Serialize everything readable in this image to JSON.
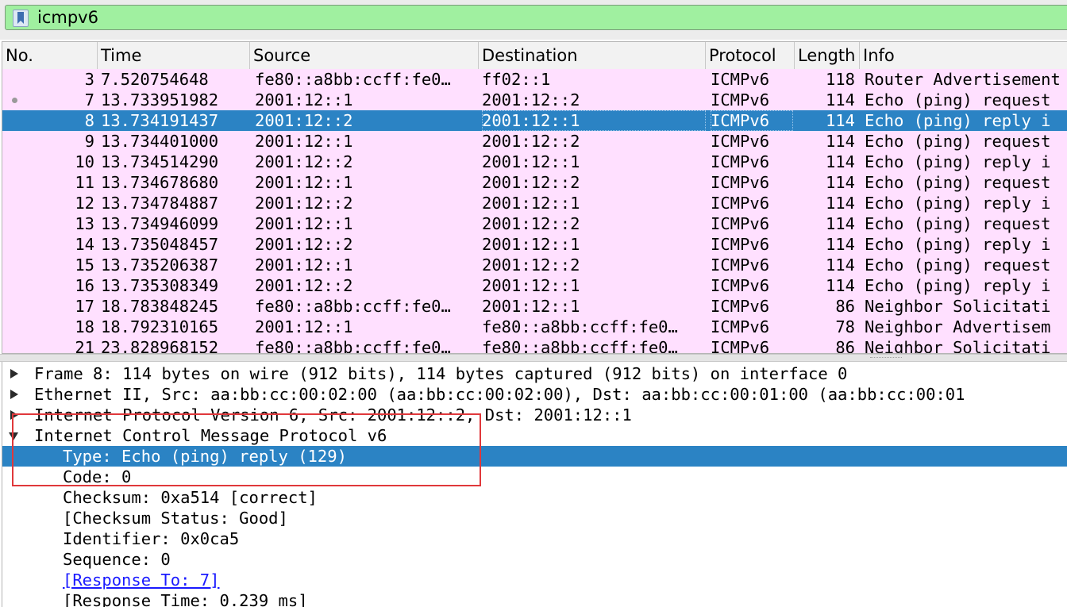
{
  "filter": {
    "value": "icmpv6",
    "icon": "bookmark-icon",
    "background": "#a0f0a0"
  },
  "packet_list": {
    "columns": [
      "No.",
      "Time",
      "Source",
      "Destination",
      "Protocol",
      "Length",
      "Info"
    ],
    "rows": [
      {
        "no": "3",
        "time": "7.520754648",
        "src": "fe80::a8bb:ccff:fe0…",
        "dst": "ff02::1",
        "proto": "ICMPv6",
        "len": "118",
        "info": "Router Advertisement",
        "selected": false,
        "related": false
      },
      {
        "no": "7",
        "time": "13.733951982",
        "src": "2001:12::1",
        "dst": "2001:12::2",
        "proto": "ICMPv6",
        "len": "114",
        "info": "Echo (ping) request",
        "selected": false,
        "related": true
      },
      {
        "no": "8",
        "time": "13.734191437",
        "src": "2001:12::2",
        "dst": "2001:12::1",
        "proto": "ICMPv6",
        "len": "114",
        "info": "Echo (ping) reply i",
        "selected": true,
        "related": false
      },
      {
        "no": "9",
        "time": "13.734401000",
        "src": "2001:12::1",
        "dst": "2001:12::2",
        "proto": "ICMPv6",
        "len": "114",
        "info": "Echo (ping) request",
        "selected": false,
        "related": false
      },
      {
        "no": "10",
        "time": "13.734514290",
        "src": "2001:12::2",
        "dst": "2001:12::1",
        "proto": "ICMPv6",
        "len": "114",
        "info": "Echo (ping) reply i",
        "selected": false,
        "related": false
      },
      {
        "no": "11",
        "time": "13.734678680",
        "src": "2001:12::1",
        "dst": "2001:12::2",
        "proto": "ICMPv6",
        "len": "114",
        "info": "Echo (ping) request",
        "selected": false,
        "related": false
      },
      {
        "no": "12",
        "time": "13.734784887",
        "src": "2001:12::2",
        "dst": "2001:12::1",
        "proto": "ICMPv6",
        "len": "114",
        "info": "Echo (ping) reply i",
        "selected": false,
        "related": false
      },
      {
        "no": "13",
        "time": "13.734946099",
        "src": "2001:12::1",
        "dst": "2001:12::2",
        "proto": "ICMPv6",
        "len": "114",
        "info": "Echo (ping) request",
        "selected": false,
        "related": false
      },
      {
        "no": "14",
        "time": "13.735048457",
        "src": "2001:12::2",
        "dst": "2001:12::1",
        "proto": "ICMPv6",
        "len": "114",
        "info": "Echo (ping) reply i",
        "selected": false,
        "related": false
      },
      {
        "no": "15",
        "time": "13.735206387",
        "src": "2001:12::1",
        "dst": "2001:12::2",
        "proto": "ICMPv6",
        "len": "114",
        "info": "Echo (ping) request",
        "selected": false,
        "related": false
      },
      {
        "no": "16",
        "time": "13.735308349",
        "src": "2001:12::2",
        "dst": "2001:12::1",
        "proto": "ICMPv6",
        "len": "114",
        "info": "Echo (ping) reply i",
        "selected": false,
        "related": false
      },
      {
        "no": "17",
        "time": "18.783848245",
        "src": "fe80::a8bb:ccff:fe0…",
        "dst": "2001:12::1",
        "proto": "ICMPv6",
        "len": "86",
        "info": "Neighbor Solicitati",
        "selected": false,
        "related": false
      },
      {
        "no": "18",
        "time": "18.792310165",
        "src": "2001:12::1",
        "dst": "fe80::a8bb:ccff:fe0…",
        "proto": "ICMPv6",
        "len": "78",
        "info": "Neighbor Advertisem",
        "selected": false,
        "related": false
      },
      {
        "no": "21",
        "time": "23.828968152",
        "src": "fe80::a8bb:ccff:fe0…",
        "dst": "fe80::a8bb:ccff:fe0…",
        "proto": "ICMPv6",
        "len": "86",
        "info": "Neighbor Solicitati",
        "selected": false,
        "related": false
      }
    ],
    "row_color": "#ffe0ff",
    "selected_color": "#2b83c4"
  },
  "detail_tree": [
    {
      "text": "Frame 8: 114 bytes on wire (912 bits), 114 bytes captured (912 bits) on interface 0",
      "level": 0,
      "arrow": "right",
      "selected": false,
      "link": false
    },
    {
      "text": "Ethernet II, Src: aa:bb:cc:00:02:00 (aa:bb:cc:00:02:00), Dst: aa:bb:cc:00:01:00 (aa:bb:cc:00:01",
      "level": 0,
      "arrow": "right",
      "selected": false,
      "link": false
    },
    {
      "text": "Internet Protocol Version 6, Src: 2001:12::2, Dst: 2001:12::1",
      "level": 0,
      "arrow": "right",
      "selected": false,
      "link": false
    },
    {
      "text": "Internet Control Message Protocol v6",
      "level": 0,
      "arrow": "down",
      "selected": false,
      "link": false
    },
    {
      "text": "Type: Echo (ping) reply (129)",
      "level": 1,
      "arrow": "",
      "selected": true,
      "link": false
    },
    {
      "text": "Code: 0",
      "level": 1,
      "arrow": "",
      "selected": false,
      "link": false
    },
    {
      "text": "Checksum: 0xa514 [correct]",
      "level": 1,
      "arrow": "",
      "selected": false,
      "link": false
    },
    {
      "text": "[Checksum Status: Good]",
      "level": 1,
      "arrow": "",
      "selected": false,
      "link": false
    },
    {
      "text": "Identifier: 0x0ca5",
      "level": 1,
      "arrow": "",
      "selected": false,
      "link": false
    },
    {
      "text": "Sequence: 0",
      "level": 1,
      "arrow": "",
      "selected": false,
      "link": false
    },
    {
      "text": "[Response To: 7]",
      "level": 1,
      "arrow": "",
      "selected": false,
      "link": true
    },
    {
      "text": "[Response Time: 0.239 ms]",
      "level": 1,
      "arrow": "",
      "selected": false,
      "link": false
    }
  ],
  "annotation_color": "#e0383b"
}
